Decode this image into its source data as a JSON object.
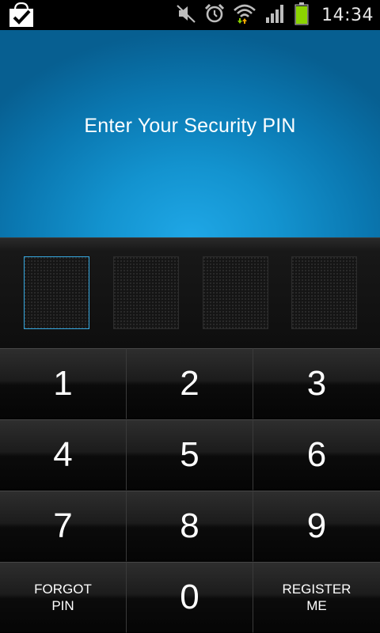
{
  "status_bar": {
    "time": "14:34",
    "icons": [
      "shopping-bag-check-icon",
      "mute-icon",
      "alarm-icon",
      "wifi-icon",
      "signal-icon",
      "battery-icon"
    ],
    "battery_color": "#8bd400"
  },
  "header": {
    "title": "Enter Your Security PIN"
  },
  "pin": {
    "length": 4,
    "active_index": 0,
    "accent": "#35a8e0"
  },
  "keypad": {
    "keys": [
      "1",
      "2",
      "3",
      "4",
      "5",
      "6",
      "7",
      "8",
      "9"
    ],
    "zero": "0",
    "forgot_line1": "FORGOT",
    "forgot_line2": "PIN",
    "register_line1": "REGISTER",
    "register_line2": "ME"
  }
}
